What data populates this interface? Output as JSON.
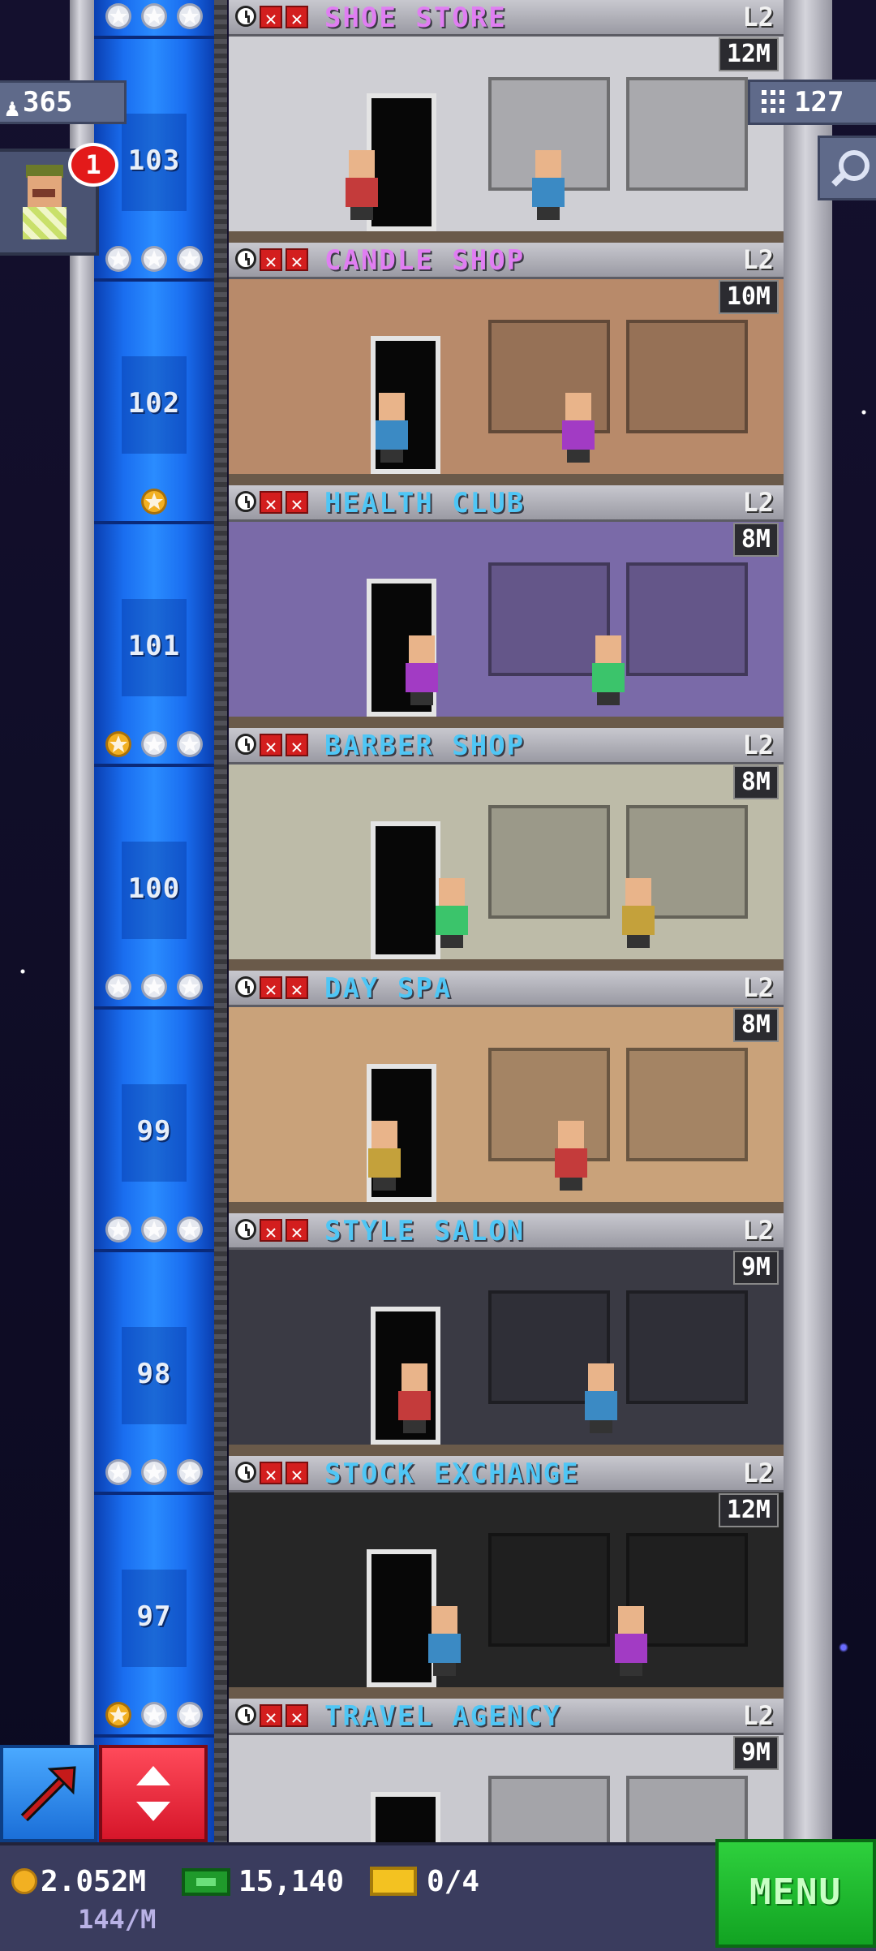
{
  "top_left": {
    "population": "365",
    "notification_count": "1"
  },
  "top_right": {
    "floors_count": "127"
  },
  "floors": [
    {
      "number": "103",
      "name": "SHOE STORE",
      "level": "L2",
      "income": "12M",
      "stars": [
        "silver",
        "silver",
        "silver"
      ],
      "name_color": "#e07ef2",
      "wall": "#cfcfd4"
    },
    {
      "number": "102",
      "name": "CANDLE SHOP",
      "level": "L2",
      "income": "10M",
      "stars": [
        "silver",
        "silver",
        "silver"
      ],
      "name_color": "#e07ef2",
      "wall": "#b88a6a"
    },
    {
      "number": "101",
      "name": "HEALTH CLUB",
      "level": "L2",
      "income": "8M",
      "stars": [
        "gold"
      ],
      "name_color": "#4fc6f5",
      "wall": "#7a6aa8"
    },
    {
      "number": "100",
      "name": "BARBER SHOP",
      "level": "L2",
      "income": "8M",
      "stars": [
        "gold",
        "silver",
        "silver"
      ],
      "name_color": "#4fc6f5",
      "wall": "#bdbba8"
    },
    {
      "number": "99",
      "name": "DAY SPA",
      "level": "L2",
      "income": "8M",
      "stars": [
        "silver",
        "silver",
        "silver"
      ],
      "name_color": "#4fc6f5",
      "wall": "#c9a27a"
    },
    {
      "number": "98",
      "name": "STYLE SALON",
      "level": "L2",
      "income": "9M",
      "stars": [
        "silver",
        "silver",
        "silver"
      ],
      "name_color": "#4fc6f5",
      "wall": "#3a3a44"
    },
    {
      "number": "97",
      "name": "STOCK EXCHANGE",
      "level": "L2",
      "income": "12M",
      "stars": [
        "silver",
        "silver",
        "silver"
      ],
      "name_color": "#4fc6f5",
      "wall": "#262626"
    },
    {
      "number": "",
      "name": "TRAVEL AGENCY",
      "level": "L2",
      "income": "9M",
      "stars": [
        "gold",
        "silver",
        "silver"
      ],
      "name_color": "#4fc6f5",
      "wall": "#c9c9cf"
    }
  ],
  "bottom_bar": {
    "coins": "2.052M",
    "rate": "144/M",
    "tower_bux": "15,140",
    "tickets": "0/4",
    "menu_label": "MENU"
  },
  "colors": {
    "elevator_blue": "#1a6ef0",
    "menu_green": "#1fbf2e",
    "gold_star": "#f2b022",
    "silver_star": "#e6e9f0"
  }
}
